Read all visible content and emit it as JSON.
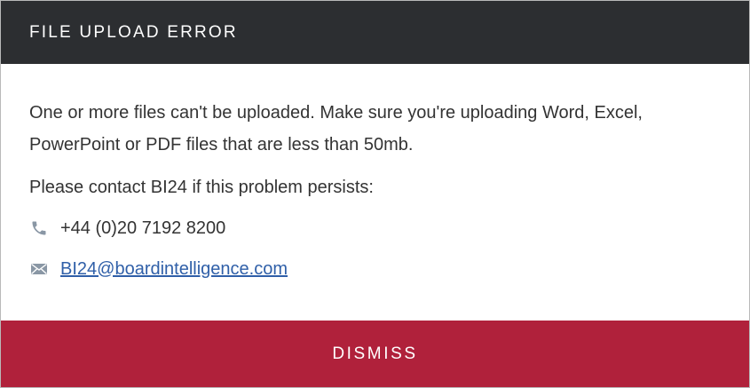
{
  "dialog": {
    "title": "FILE UPLOAD ERROR",
    "message": "One or more files can't be uploaded. Make sure you're uploading Word, Excel, PowerPoint or PDF files that are less than 50mb.",
    "contact_prompt": "Please contact BI24 if this problem persists:",
    "phone": {
      "icon": "phone-icon",
      "number": "+44 (0)20 7192 8200"
    },
    "email": {
      "icon": "envelope-icon",
      "address": "BI24@boardintelligence.com"
    },
    "dismiss_label": "DISMISS"
  },
  "colors": {
    "header_bg": "#2c2e31",
    "dismiss_bg": "#b0213b",
    "link": "#2f5fa8",
    "text": "#333333",
    "icon": "#8a97a5"
  }
}
